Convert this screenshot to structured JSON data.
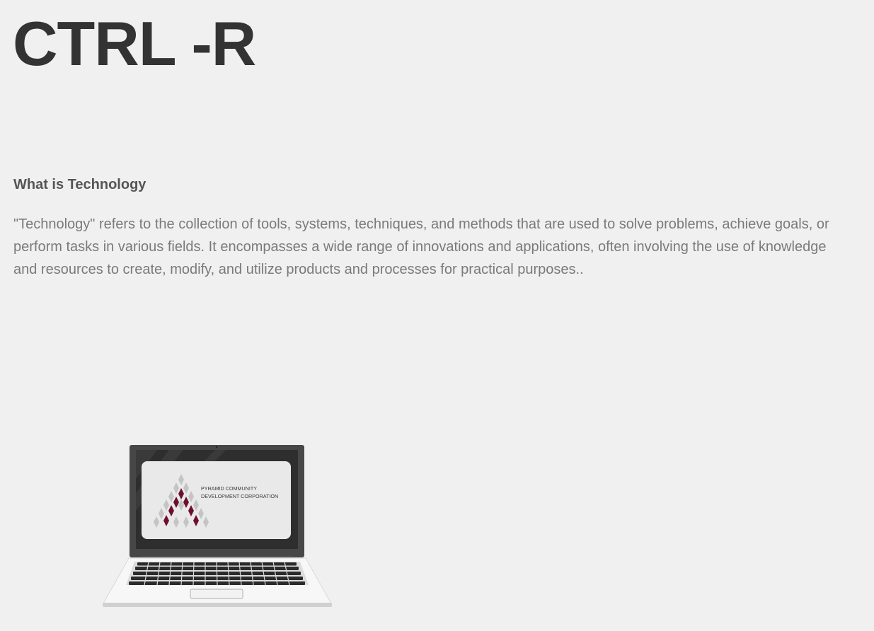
{
  "header": {
    "brand": "CTRL -R"
  },
  "article": {
    "heading": "What is Technology",
    "body": "\"Technology\" refers to the collection of tools, systems, techniques, and methods that are used to solve problems, achieve goals, or perform tasks in various fields. It encompasses a wide range of innovations and applications, often involving the use of knowledge and resources to create, modify, and utilize products and processes for practical purposes.."
  },
  "illustration": {
    "screen_logo_line1": "PYRAMID COMMUNITY",
    "screen_logo_line2": "DEVELOPMENT CORPORATION",
    "colors": {
      "accent": "#6e0f2e",
      "diamond_grey": "#c4c4c4",
      "bezel": "#474747"
    }
  }
}
